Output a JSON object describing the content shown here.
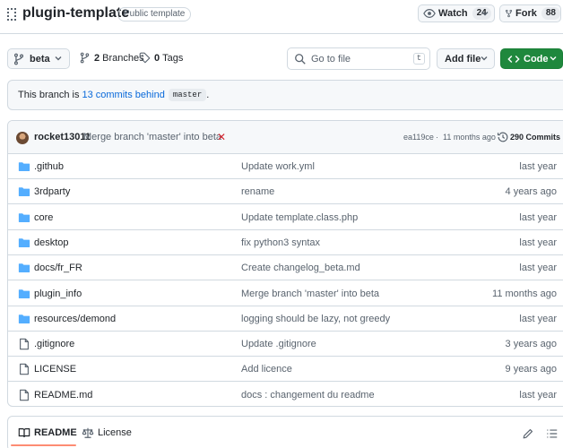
{
  "repo": {
    "name": "plugin-template",
    "visibility": "Public template",
    "watch_label": "Watch",
    "watch_count": "24",
    "fork_label": "Fork",
    "fork_count": "88"
  },
  "toolbar": {
    "branch": "beta",
    "branches_count": "2",
    "branches_label": "Branches",
    "tags_count": "0",
    "tags_label": "Tags",
    "search_placeholder": "Go to file",
    "search_shortcut": "t",
    "add_file_label": "Add file",
    "code_label": "Code"
  },
  "banner": {
    "prefix": "This branch is",
    "link": "13 commits behind",
    "base": "master",
    "suffix": "."
  },
  "latest_commit": {
    "author": "rocket13011",
    "message": "Merge branch 'master' into beta",
    "status": "✕",
    "hash": "ea119ce",
    "separator": "·",
    "time": "11 months ago",
    "commits_count": "290 Commits"
  },
  "files": [
    {
      "type": "folder",
      "name": ".github",
      "message": "Update work.yml",
      "date": "last year"
    },
    {
      "type": "folder",
      "name": "3rdparty",
      "message": "rename",
      "date": "4 years ago"
    },
    {
      "type": "folder",
      "name": "core",
      "message": "Update template.class.php",
      "date": "last year"
    },
    {
      "type": "folder",
      "name": "desktop",
      "message": "fix python3 syntax",
      "date": "last year"
    },
    {
      "type": "folder",
      "name": "docs/fr_FR",
      "message": "Create changelog_beta.md",
      "date": "last year"
    },
    {
      "type": "folder",
      "name": "plugin_info",
      "message": "Merge branch 'master' into beta",
      "date": "11 months ago"
    },
    {
      "type": "folder",
      "name": "resources/demond",
      "message": "logging should be lazy, not greedy",
      "date": "last year"
    },
    {
      "type": "file",
      "name": ".gitignore",
      "message": "Update .gitignore",
      "date": "3 years ago"
    },
    {
      "type": "file",
      "name": "LICENSE",
      "message": "Add licence",
      "date": "9 years ago"
    },
    {
      "type": "file",
      "name": "README.md",
      "message": "docs : changement du readme",
      "date": "last year"
    }
  ],
  "readme_bar": {
    "readme_tab": "README",
    "license_tab": "License"
  },
  "colors": {
    "accent": "#0969da",
    "code_button": "#1f883d",
    "folder": "#54aeff",
    "error": "#d1242f",
    "tab_underline": "#fd8c73"
  }
}
